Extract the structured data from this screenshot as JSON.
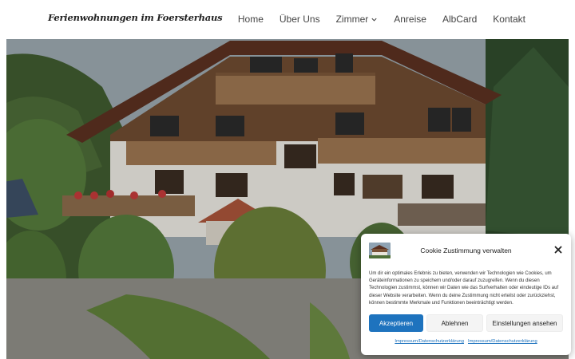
{
  "header": {
    "logo": "Ferienwohnungen im Foersterhaus",
    "nav": [
      {
        "label": "Home"
      },
      {
        "label": "Über Uns"
      },
      {
        "label": "Zimmer"
      },
      {
        "label": "Anreise"
      },
      {
        "label": "AlbCard"
      },
      {
        "label": "Kontakt"
      }
    ]
  },
  "cookie": {
    "title": "Cookie Zustimmung verwalten",
    "text": "Um dir ein optimales Erlebnis zu bieten, verwenden wir Technologien wie Cookies, um Geräteinformationen zu speichern und/oder darauf zuzugreifen. Wenn du diesen Technologien zustimmst, können wir Daten wie das Surfverhalten oder eindeutige IDs auf dieser Website verarbeiten. Wenn du deine Zustimmung nicht erteilst oder zurückziehst, können bestimmte Merkmale und Funktionen beeinträchtigt werden.",
    "accept": "Akzeptieren",
    "deny": "Ablehnen",
    "settings": "Einstellungen ansehen",
    "links": [
      "Impressum/Datenschutzerklärung",
      "Impressum/Datenschutzerklärung"
    ]
  },
  "colors": {
    "accent": "#1e73be",
    "header_bg": "#ffffff",
    "text": "#444444"
  }
}
